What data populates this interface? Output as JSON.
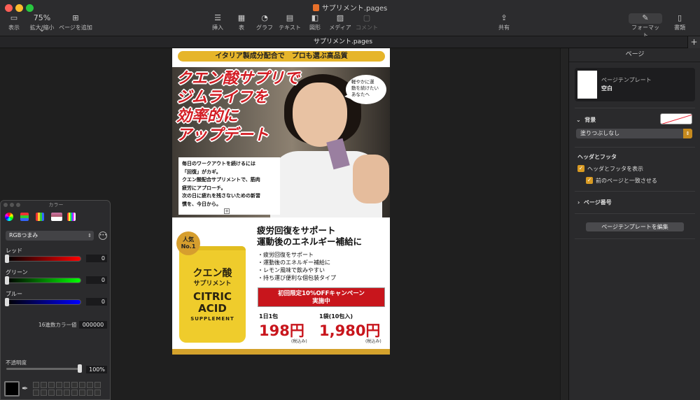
{
  "window": {
    "title": "サプリメント.pages",
    "tab_label": "サプリメント.pages"
  },
  "toolbar": {
    "view": "表示",
    "zoom_value": "75%",
    "zoom": "拡大/縮小",
    "add_page": "ページを追加",
    "insert": "挿入",
    "table": "表",
    "chart": "グラフ",
    "text": "テキスト",
    "shape": "図形",
    "media": "メディア",
    "comment": "コメント",
    "share": "共有",
    "format": "フォーマット",
    "document": "書類"
  },
  "page": {
    "banner": "イタリア製成分配合で　プロも選ぶ高品質",
    "headline": [
      "クエン酸サプリで",
      "ジムライフを",
      "効率的に",
      "アップデート"
    ],
    "bubble": [
      "軽やかに運",
      "動を続けたい",
      "あなたへ"
    ],
    "body": [
      "毎日のワークアウトを続けるには",
      "「回復」がカギ。",
      "クエン酸配合サプリメントで、筋肉",
      "疲労にアプローチ。",
      "次の日に疲れを残さないための新習",
      "慣を、今日から。"
    ],
    "badge": [
      "人気",
      "No.1"
    ],
    "pack": {
      "jp_name": "クエン酸",
      "jp_sub": "サプリメント",
      "en_line1": "CITRIC",
      "en_line2": "ACID",
      "en_sub": "SUPPLEMENT"
    },
    "product_heading": [
      "疲労回復をサポート",
      "運動後のエネルギー補給に"
    ],
    "bullets": [
      "・疲労回復をサポート",
      "・運動後のエネルギー補給に",
      "・レモン風味で飲みやすい",
      "・持ち運び便利な個包装タイプ"
    ],
    "promo": [
      "初回限定10%OFFキャンペーン",
      "実施中"
    ],
    "price1": {
      "label": "1日1包",
      "value": "198円",
      "tax": "(税込み)"
    },
    "price2": {
      "label": "1袋(10包入)",
      "value": "1,980円",
      "tax": "(税込み)"
    }
  },
  "inspector": {
    "header": "ページ",
    "template_label": "ページテンプレート",
    "template_name": "空白",
    "background": "背景",
    "fill": "塗りつぶしなし",
    "header_footer": "ヘッダとフッタ",
    "show_header_footer": "ヘッダとフッタを表示",
    "match_previous": "前のページと一致させる",
    "page_number": "ページ番号",
    "edit_template": "ページテンプレートを編集"
  },
  "color_panel": {
    "title": "カラー",
    "mode": "RGBつまみ",
    "red_label": "レッド",
    "red": "0",
    "green_label": "グリーン",
    "green": "0",
    "blue_label": "ブルー",
    "blue": "0",
    "hex_label": "16進数カラー値",
    "hex": "000000",
    "opacity_label": "不透明度",
    "opacity": "100%"
  },
  "colors": {
    "accent": "#d89a22",
    "headline_red": "#d31d24",
    "promo_red": "#c8151c",
    "gold": "#e6b52a",
    "pack_yellow": "#efcc2c"
  }
}
